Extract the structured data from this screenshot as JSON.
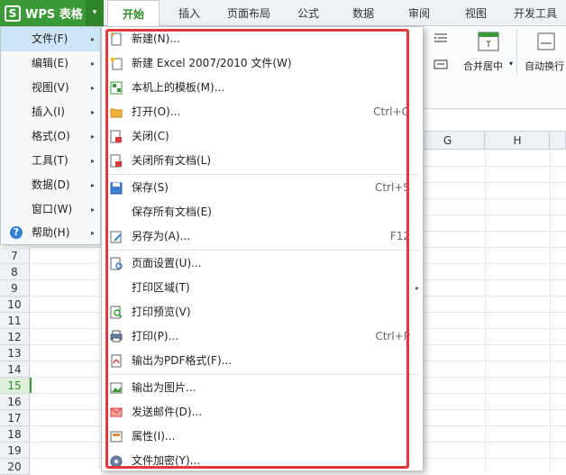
{
  "app": {
    "name": "WPS 表格",
    "logo_letter": "S",
    "menu_arrow": "▾"
  },
  "tabs": [
    {
      "label": "开始",
      "active": true
    },
    {
      "label": "插入"
    },
    {
      "label": "页面布局"
    },
    {
      "label": "公式"
    },
    {
      "label": "数据"
    },
    {
      "label": "审阅"
    },
    {
      "label": "视图"
    },
    {
      "label": "开发工具"
    }
  ],
  "ribbon": {
    "merge_center": "合并居中",
    "merge_center_arrow": "▾",
    "auto_wrap": "自动换行"
  },
  "left_menu": [
    {
      "label": "文件(F)",
      "active": true
    },
    {
      "label": "编辑(E)"
    },
    {
      "label": "视图(V)"
    },
    {
      "label": "插入(I)"
    },
    {
      "label": "格式(O)"
    },
    {
      "label": "工具(T)"
    },
    {
      "label": "数据(D)"
    },
    {
      "label": "窗口(W)"
    },
    {
      "label": "帮助(H)",
      "icon": "?"
    }
  ],
  "submenu": [
    {
      "label": "新建(N)...",
      "icon": "new-doc-icon"
    },
    {
      "label": "新建 Excel 2007/2010 文件(W)",
      "icon": "new-excel-icon"
    },
    {
      "label": "本机上的模板(M)...",
      "icon": "template-icon"
    },
    {
      "label": "打开(O)...",
      "shortcut": "Ctrl+O",
      "icon": "folder-open-icon"
    },
    {
      "label": "关闭(C)",
      "icon": "close-doc-icon"
    },
    {
      "label": "关闭所有文档(L)",
      "icon": "close-all-icon"
    },
    {
      "label": "保存(S)",
      "shortcut": "Ctrl+S",
      "icon": "save-icon"
    },
    {
      "label": "保存所有文档(E)"
    },
    {
      "label": "另存为(A)...",
      "shortcut": "F12",
      "icon": "save-as-icon"
    },
    {
      "label": "页面设置(U)...",
      "icon": "page-setup-icon"
    },
    {
      "label": "打印区域(T)",
      "submenu": true
    },
    {
      "label": "打印预览(V)",
      "icon": "print-preview-icon"
    },
    {
      "label": "打印(P)...",
      "shortcut": "Ctrl+P",
      "icon": "printer-icon"
    },
    {
      "label": "输出为PDF格式(F)...",
      "icon": "pdf-icon"
    },
    {
      "label": "输出为图片...",
      "icon": "image-icon"
    },
    {
      "label": "发送邮件(D)...",
      "icon": "mail-icon"
    },
    {
      "label": "属性(I)...",
      "icon": "properties-icon"
    },
    {
      "label": "文件加密(Y)...",
      "icon": "encrypt-icon"
    }
  ],
  "submenu_arrow": "▸",
  "left_menu_arrow": "▸",
  "columns": [
    "G",
    "H"
  ],
  "rows": [
    "7",
    "8",
    "9",
    "10",
    "11",
    "12",
    "13",
    "14",
    "15",
    "16",
    "17",
    "18",
    "19",
    "20"
  ],
  "selected_row": "15",
  "colors": {
    "brand": "#3a9a35",
    "highlight": "#e03a3e",
    "menu_active": "#cde6f7"
  }
}
